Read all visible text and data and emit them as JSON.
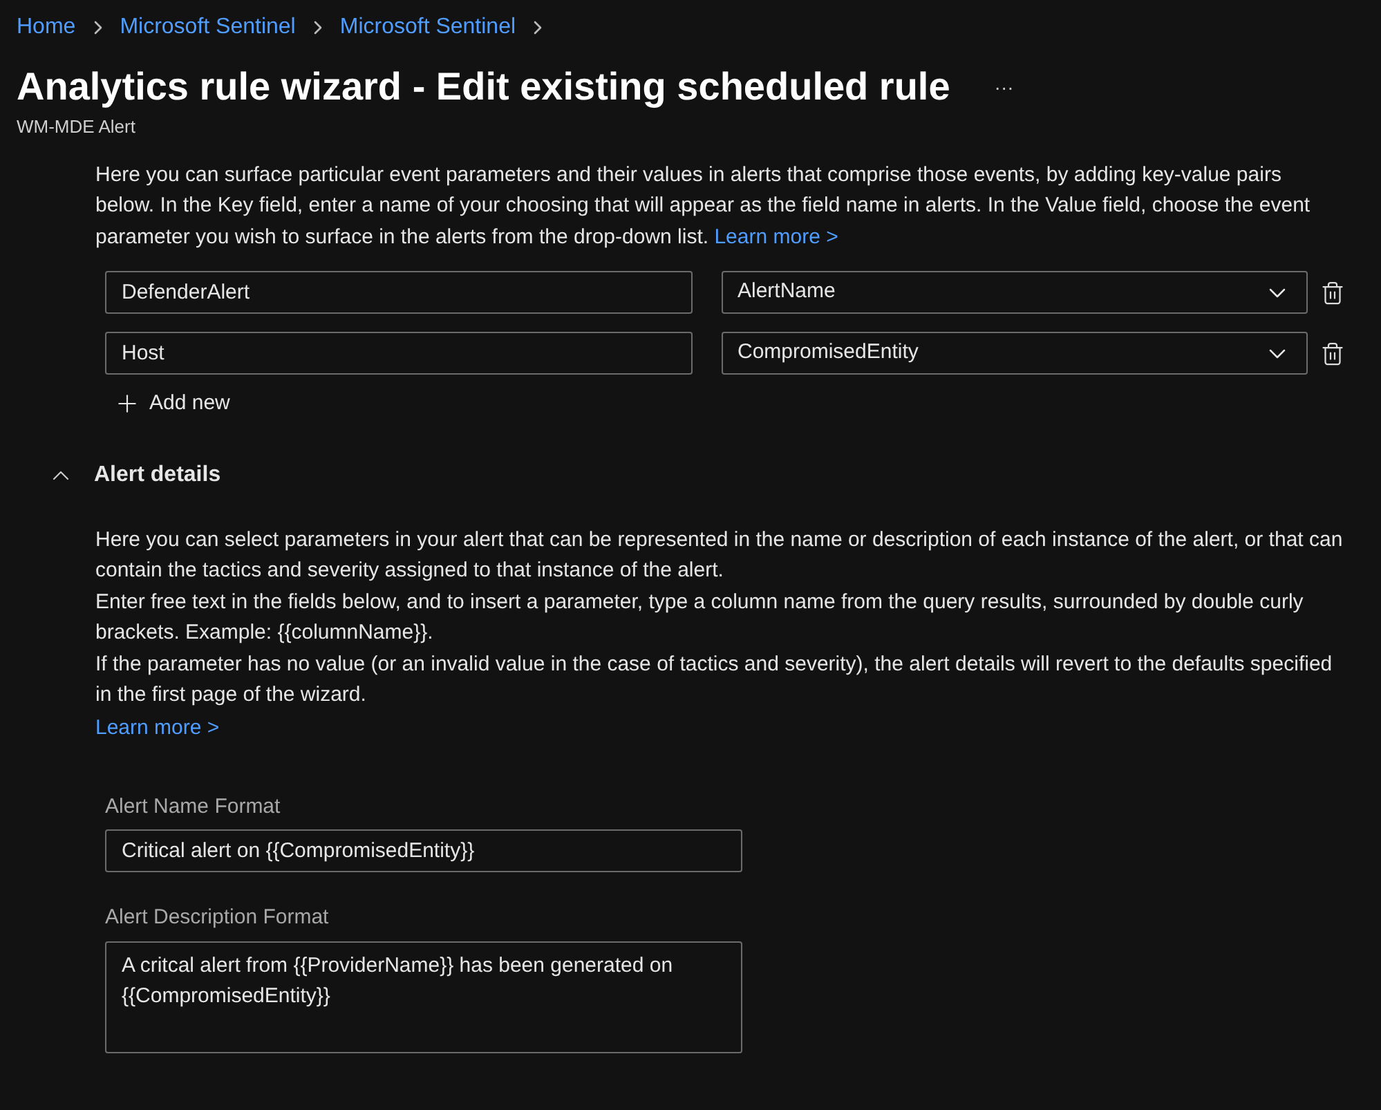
{
  "breadcrumb": [
    "Home",
    "Microsoft Sentinel",
    "Microsoft Sentinel"
  ],
  "title": "Analytics rule wizard - Edit existing scheduled rule",
  "more_button": "···",
  "subtitle": "WM-MDE Alert",
  "custom_details": {
    "description": "Here you can surface particular event parameters and their values in alerts that comprise those events, by adding key-value pairs below. In the Key field, enter a name of your choosing that will appear as the field name in alerts. In the Value field, choose the event parameter you wish to surface in the alerts from the drop-down list.",
    "link": "Learn more >",
    "pairs": [
      {
        "key": "DefenderAlert",
        "value": "AlertName"
      },
      {
        "key": "Host",
        "value": "CompromisedEntity"
      }
    ],
    "add_button": "Add new"
  },
  "alert_details": {
    "title": "Alert details",
    "expanded": true,
    "paragraphs": [
      "Here you can select parameters in your alert that can be represented in the name or description of each instance of the alert, or that can contain the tactics and severity assigned to that instance of the alert.",
      "Enter free text in the fields below, and to insert a parameter, type a column name from the query results, surrounded by double curly brackets. Example: {{columnName}}.",
      "If the parameter has no value (or an invalid value in the case of tactics and severity), the alert details will revert to the defaults specified in the first page of the wizard."
    ],
    "link": "Learn more >",
    "fields": [
      {
        "label": "Alert Name Format",
        "value": "Critical alert on {{CompromisedEntity}}",
        "kind": "input"
      },
      {
        "label": "Alert Description Format",
        "value": "A critcal alert from {{ProviderName}} has been generated on {{CompromisedEntity}}",
        "kind": "textarea"
      }
    ]
  }
}
